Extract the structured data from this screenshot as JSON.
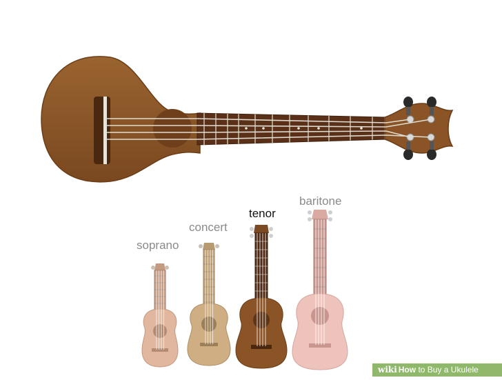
{
  "sizes": {
    "soprano": "soprano",
    "concert": "concert",
    "tenor": "tenor",
    "baritone": "baritone",
    "highlighted": "tenor"
  },
  "watermark": {
    "wiki": "wiki",
    "how": "How",
    "rest": " to Buy a Ukulele"
  },
  "colors": {
    "main_body": "#8a5426",
    "main_body_edge": "#6b3d17",
    "soundhole": "#6e3f1a",
    "fretboard": "#5a3018",
    "soprano_body": "#e2b79f",
    "concert_body": "#cfae83",
    "tenor_body": "#8a5426",
    "baritone_body": "#eec3bc",
    "watermark_bg": "#8fb86a"
  }
}
